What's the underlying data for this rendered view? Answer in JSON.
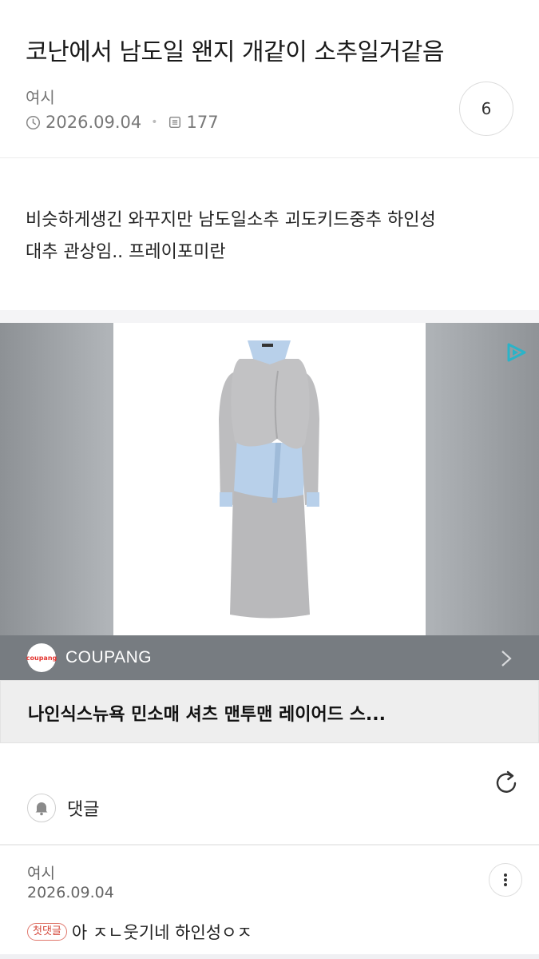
{
  "post": {
    "title": "코난에서 남도일 왠지 개같이 소추일거같음",
    "author": "여시",
    "date": "2026.09.04",
    "views": "177",
    "comment_count": "6",
    "body_lines": [
      "비슷하게생긴 와꾸지만 남도일소추 괴도키드중추 하인성",
      "대추 관상임.. 프레이포미란"
    ]
  },
  "ad": {
    "source_logo_text": "coupang",
    "source_name": "COUPANG",
    "caption": "나인식스뉴욕 민소매 셔츠 맨투맨 레이어드 스..."
  },
  "comments_section": {
    "label": "댓글"
  },
  "comments": [
    {
      "author": "여시",
      "date": "2026.09.04",
      "badge": "첫댓글",
      "text": "아 ㅈㄴ웃기네 하인성ㅇㅈ"
    }
  ],
  "colors": {
    "accent_ad_logo": "#2bb3c8",
    "badge_red": "#d4473a"
  }
}
